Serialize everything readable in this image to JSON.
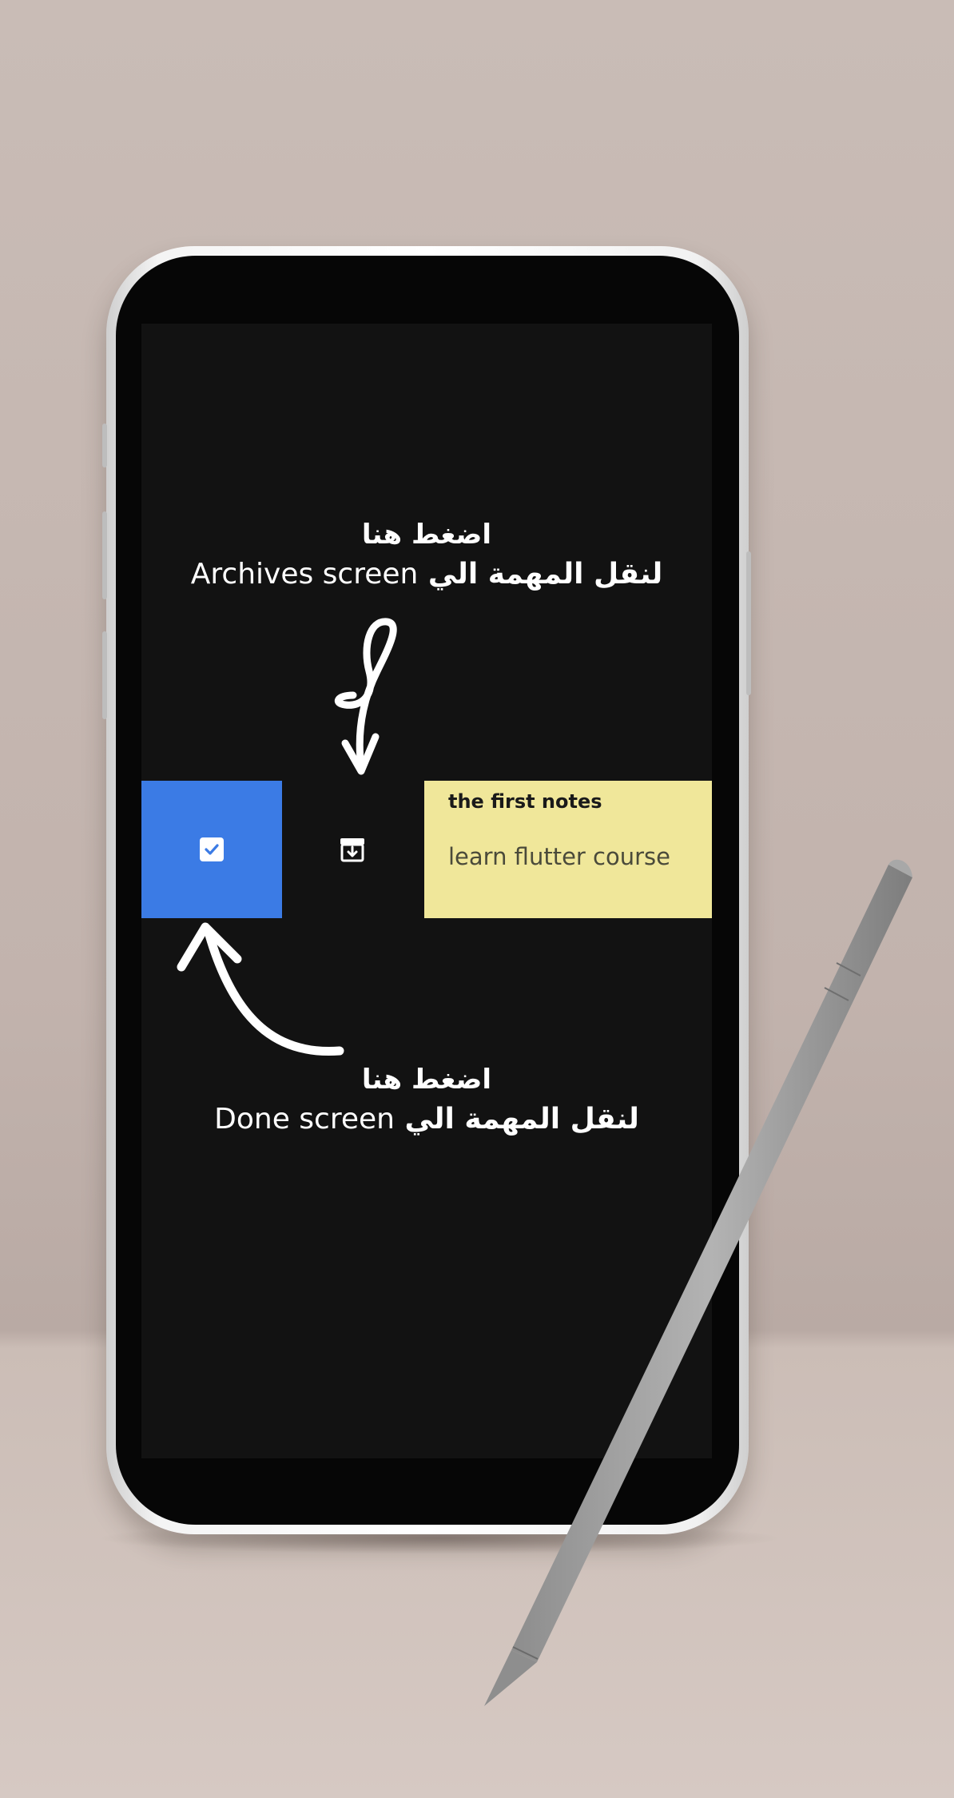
{
  "annotations": {
    "archive": {
      "line1": "اضغط هنا",
      "line2_ar": "لنقل المهمة الي",
      "line2_en": "Archives screen"
    },
    "done": {
      "line1": "اضغط هنا",
      "line2_ar": "لنقل المهمة الي",
      "line2_en": "Done screen"
    }
  },
  "task": {
    "title": "the first notes",
    "body": "learn flutter course",
    "done_action_icon": "check-box-icon",
    "archive_action_icon": "archive-icon"
  },
  "colors": {
    "done_action": "#3b7be5",
    "note_card": "#f0e79a",
    "screen_bg": "#121212"
  }
}
